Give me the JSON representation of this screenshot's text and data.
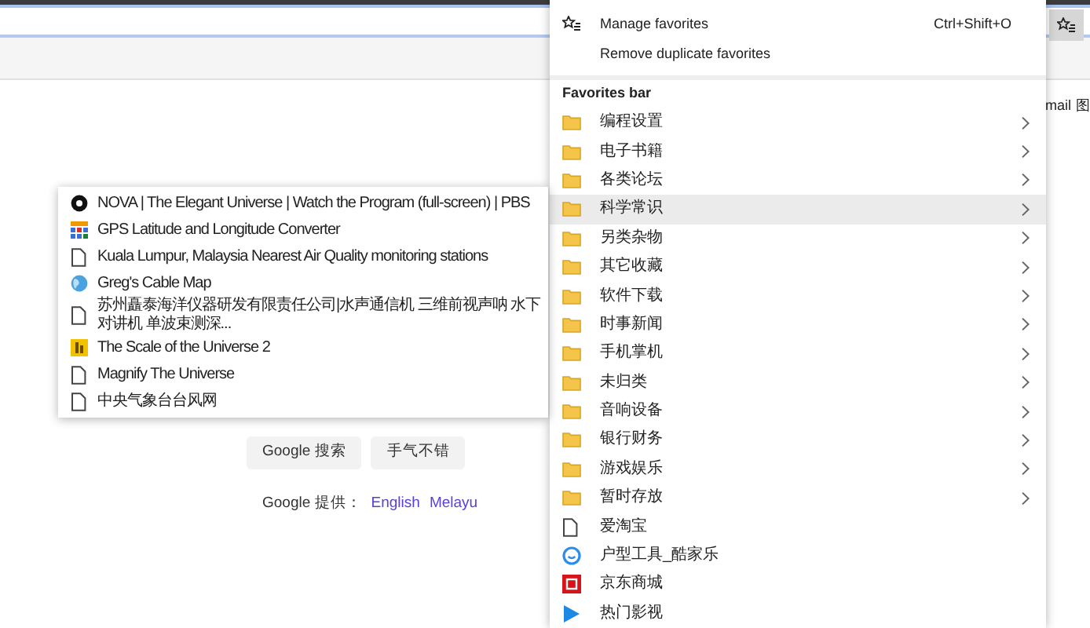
{
  "toolbar": {
    "favorites_button": {
      "selected": true
    }
  },
  "page": {
    "side_text": [
      "mail",
      "图"
    ],
    "buttons": [
      "Google 搜索",
      "手气不错"
    ],
    "languages_label": "Google 提供：",
    "languages": [
      "English",
      "Melayu"
    ]
  },
  "favorites_menu": {
    "actions": [
      {
        "label": "Manage favorites",
        "shortcut": "Ctrl+Shift+O",
        "kind": "manage"
      },
      {
        "label": "Remove duplicate favorites",
        "kind": "plain"
      }
    ],
    "section_title": "Favorites bar",
    "items": [
      {
        "label": "编程设置",
        "kind": "folder",
        "selected": false
      },
      {
        "label": "电子书籍",
        "kind": "folder",
        "selected": false
      },
      {
        "label": "各类论坛",
        "kind": "folder",
        "selected": false
      },
      {
        "label": "科学常识",
        "kind": "folder",
        "selected": true
      },
      {
        "label": "另类杂物",
        "kind": "folder",
        "selected": false
      },
      {
        "label": "其它收藏",
        "kind": "folder",
        "selected": false
      },
      {
        "label": "软件下载",
        "kind": "folder",
        "selected": false
      },
      {
        "label": "时事新闻",
        "kind": "folder",
        "selected": false
      },
      {
        "label": "手机掌机",
        "kind": "folder",
        "selected": false
      },
      {
        "label": "未归类",
        "kind": "folder",
        "selected": false
      },
      {
        "label": "音响设备",
        "kind": "folder",
        "selected": false
      },
      {
        "label": "银行财务",
        "kind": "folder",
        "selected": false
      },
      {
        "label": "游戏娱乐",
        "kind": "folder",
        "selected": false
      },
      {
        "label": "暂时存放",
        "kind": "folder",
        "selected": false
      },
      {
        "label": "爱淘宝",
        "kind": "page",
        "selected": false
      },
      {
        "label": "户型工具_酷家乐",
        "kind": "smiley",
        "selected": false
      },
      {
        "label": "京东商城",
        "kind": "jd",
        "selected": false
      },
      {
        "label": "热门影视",
        "kind": "play",
        "selected": false
      }
    ]
  },
  "submenu": {
    "items": [
      {
        "label": "NOVA | The Elegant Universe | Watch the Program (full-screen) | PBS",
        "kind": "nova"
      },
      {
        "label": "GPS Latitude and Longitude Converter",
        "kind": "grid"
      },
      {
        "label": "Kuala Lumpur, Malaysia Nearest Air Quality monitoring stations",
        "kind": "page"
      },
      {
        "label": "Greg's Cable Map",
        "kind": "globe"
      },
      {
        "label": "苏州矗泰海洋仪器研发有限责任公司|水声通信机 三维前视声呐 水下对讲机 单波束测深...",
        "kind": "page"
      },
      {
        "label": "The Scale of the Universe 2",
        "kind": "scale"
      },
      {
        "label": "Magnify The Universe",
        "kind": "page"
      },
      {
        "label": "中央气象台台风网",
        "kind": "page"
      }
    ]
  }
}
